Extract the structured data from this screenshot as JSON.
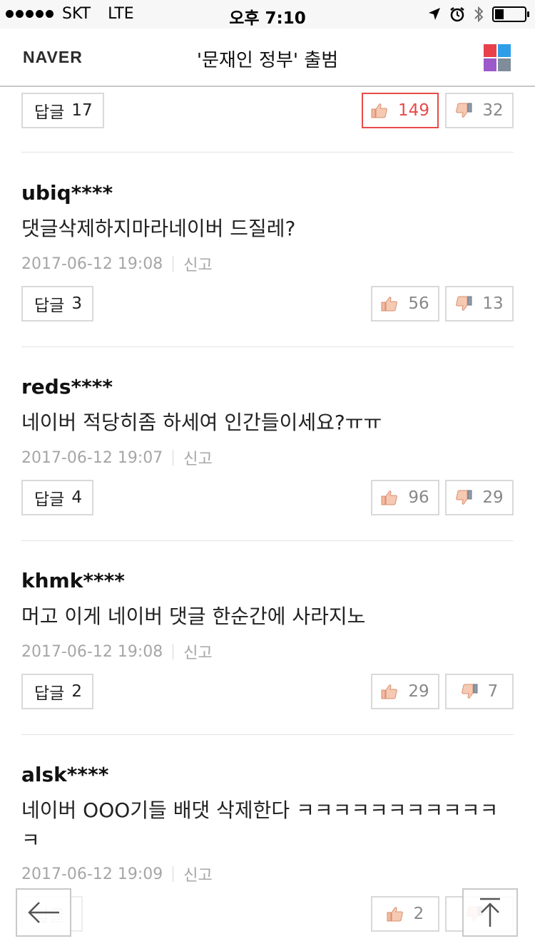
{
  "status_bar": {
    "carrier": "SKT",
    "network": "LTE",
    "time": "오후 7:10"
  },
  "header": {
    "logo": "NAVER",
    "title": "'문재인 정부' 출범",
    "menu_colors": [
      "#e8414a",
      "#2f9ee8",
      "#9b59c9",
      "#7f8c99"
    ]
  },
  "top_actions": {
    "reply_label": "답글",
    "reply_count": "17",
    "likes": "149",
    "dislikes": "32"
  },
  "comments": [
    {
      "username": "ubiq****",
      "text": "댓글삭제하지마라네이버 드질레?",
      "date": "2017-06-12 19:08",
      "report": "신고",
      "reply_label": "답글",
      "reply_count": "3",
      "likes": "56",
      "dislikes": "13"
    },
    {
      "username": "reds****",
      "text": "네이버 적당히좀 하세여 인간들이세요?ㅠㅠ",
      "date": "2017-06-12 19:07",
      "report": "신고",
      "reply_label": "답글",
      "reply_count": "4",
      "likes": "96",
      "dislikes": "29"
    },
    {
      "username": "khmk****",
      "text": "머고 이게 네이버 댓글 한순간에 사라지노",
      "date": "2017-06-12 19:08",
      "report": "신고",
      "reply_label": "답글",
      "reply_count": "2",
      "likes": "29",
      "dislikes": "7"
    },
    {
      "username": "alsk****",
      "text": "네이버 OOO기들 배댓 삭제한다 ㅋㅋㅋㅋㅋㅋㅋㅋㅋㅋㅋㅋ",
      "date": "2017-06-12 19:09",
      "report": "신고",
      "reply_label": "답글",
      "reply_count": "",
      "likes": "2",
      "dislikes": ""
    }
  ],
  "icons": {
    "back": "arrow-left-icon",
    "top": "arrow-up-icon",
    "like": "thumbs-up-icon",
    "dislike": "thumbs-down-icon"
  }
}
